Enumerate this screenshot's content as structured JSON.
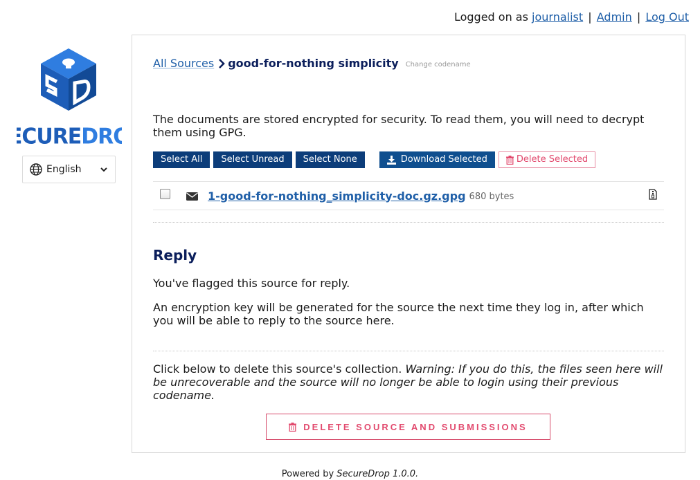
{
  "topbar": {
    "prefix": "Logged on as",
    "user": "journalist",
    "sep": "|",
    "admin": "Admin",
    "logout": "Log Out"
  },
  "language": {
    "selected": "English"
  },
  "breadcrumb": {
    "all_sources": "All Sources",
    "codename": "good-for-nothing simplicity",
    "change": "Change codename"
  },
  "notice": "The documents are stored encrypted for security. To read them, you will need to decrypt them using GPG.",
  "actions": {
    "select_all": "Select All",
    "select_unread": "Select Unread",
    "select_none": "Select None",
    "download_selected": "Download Selected",
    "delete_selected": "Delete Selected"
  },
  "files": [
    {
      "name": "1-good-for-nothing_simplicity-doc.gz.gpg",
      "size": "680 bytes"
    }
  ],
  "reply": {
    "heading": "Reply",
    "flagged": "You've flagged this source for reply.",
    "key_notice": "An encryption key will be generated for the source the next time they log in, after which you will be able to reply to the source here."
  },
  "delete_section": {
    "intro": "Click below to delete this source's collection.",
    "warning": "Warning: If you do this, the files seen here will be unrecoverable and the source will no longer be able to login using their previous codename.",
    "button": "DELETE SOURCE AND SUBMISSIONS"
  },
  "footer": {
    "prefix": "Powered by",
    "product": "SecureDrop 1.0.0."
  },
  "colors": {
    "primary": "#0c3d7a",
    "link": "#1f5fa8",
    "heading": "#0b1e5b",
    "danger": "#e24a6e",
    "logo_blue": "#2a6fc9",
    "logo_dark": "#0f3c7f"
  }
}
